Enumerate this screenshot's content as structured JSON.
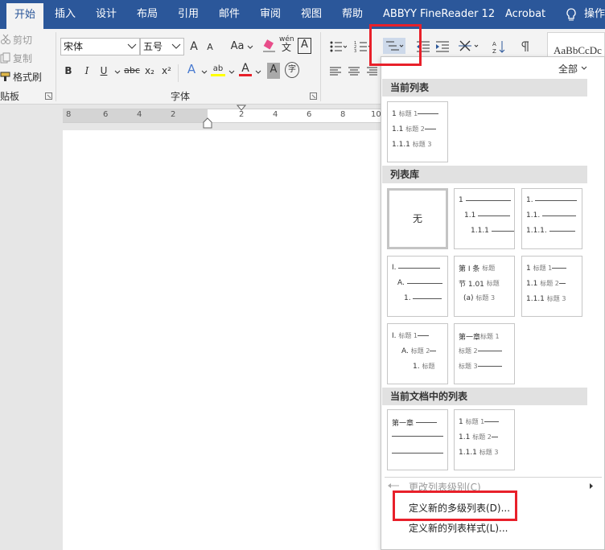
{
  "tabs": [
    "开始",
    "插入",
    "设计",
    "布局",
    "引用",
    "邮件",
    "审阅",
    "视图",
    "帮助",
    "ABBYY FineReader 12",
    "Acrobat",
    "操作"
  ],
  "clipboard": {
    "cut": "剪切",
    "copy": "复制",
    "format_painter": "格式刷",
    "group": "贴板"
  },
  "font": {
    "name": "宋体",
    "size": "五号",
    "group": "字体",
    "aa": "Aa",
    "bold": "B",
    "italic": "I",
    "underline": "U",
    "strike": "abc",
    "sub": "x₂",
    "sup": "x²",
    "pinyin_top": "wén",
    "pinyin_bottom": "文",
    "border_char": "A",
    "char_a": "A",
    "char_shade": "A",
    "enclose": "字",
    "highlight": "ab",
    "color_a": "A",
    "grow": "A",
    "shrink": "A"
  },
  "styles": {
    "sample": "AaBbCcDc"
  },
  "ruler": [
    "8",
    "6",
    "4",
    "2",
    "2",
    "4",
    "6",
    "8",
    "10"
  ],
  "dropdown": {
    "filter": "全部",
    "current_header": "当前列表",
    "library_header": "列表库",
    "doc_header": "当前文档中的列表",
    "none_label": "无",
    "heading_word": "标题",
    "change_level": "更改列表级别(C)",
    "define_multilevel": "定义新的多级列表(D)...",
    "define_style": "定义新的列表样式(L)..."
  },
  "thumbs": {
    "current": [
      [
        "1",
        "标题 1"
      ],
      [
        "1.1",
        "标题 2"
      ],
      [
        "1.1.1",
        "标题 3"
      ]
    ],
    "lib1": [
      "1",
      "1.1",
      "1.1.1"
    ],
    "lib2": [
      "1.",
      "1.1.",
      "1.1.1."
    ],
    "lib3": [
      "I.",
      "A.",
      "1."
    ],
    "lib4": [
      [
        "第 Ⅰ 条",
        "标题"
      ],
      [
        "节 1.01",
        "标题"
      ],
      [
        "(a)",
        "标题 3"
      ]
    ],
    "lib5": [
      [
        "1",
        "标题 1"
      ],
      [
        "1.1",
        "标题 2"
      ],
      [
        "1.1.1",
        "标题 3"
      ]
    ],
    "lib6": [
      [
        "I.",
        "标题 1"
      ],
      [
        "A.",
        "标题 2"
      ],
      [
        "1.",
        "标题"
      ]
    ],
    "lib7": [
      [
        "第一章",
        "标题 1"
      ],
      [
        "",
        "标题 2"
      ],
      [
        "",
        "标题 3"
      ]
    ],
    "doc1": [
      "第一章"
    ],
    "doc2": [
      [
        "1",
        "标题 1"
      ],
      [
        "1.1",
        "标题 2"
      ],
      [
        "1.1.1",
        "标题 3"
      ]
    ]
  },
  "colors": {
    "ribbon_blue": "#2b579a",
    "highlight_red": "#e8202a"
  }
}
